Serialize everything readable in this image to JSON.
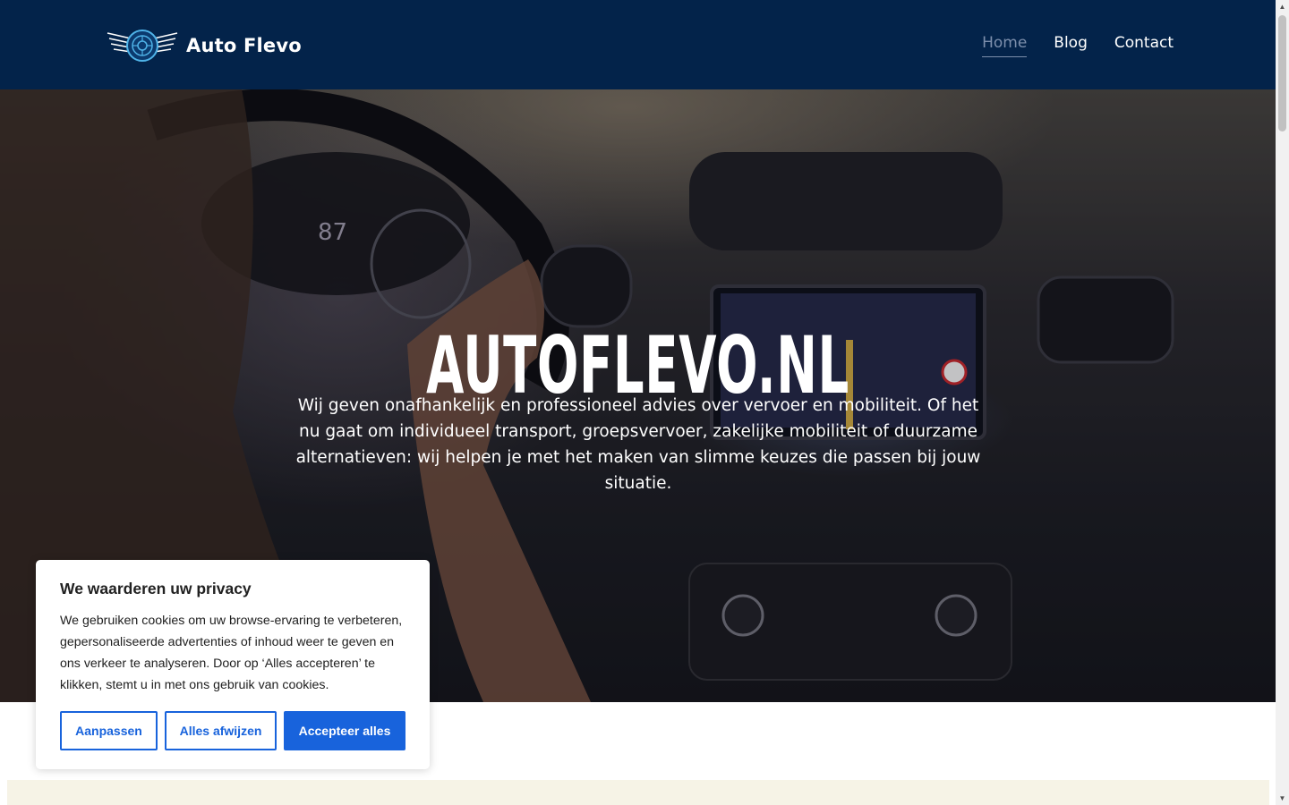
{
  "brand": {
    "name": "Auto Flevo",
    "logo_icon": "winged-wheel-icon"
  },
  "nav": {
    "items": [
      {
        "label": "Home",
        "active": true
      },
      {
        "label": "Blog",
        "active": false
      },
      {
        "label": "Contact",
        "active": false
      }
    ]
  },
  "hero": {
    "title": "AUTOFLEVO.NL",
    "subtitle": "Wij geven onafhankelijk en professioneel advies over vervoer en mobiliteit. Of het nu gaat om individueel transport, groepsvervoer, zakelijke mobiliteit of duurzame alternatieven: wij helpen je met het maken van slimme keuzes die passen bij jouw situatie."
  },
  "cookie_banner": {
    "title": "We waarderen uw privacy",
    "text": "We gebruiken cookies om uw browse-ervaring te verbeteren, gepersonaliseerde advertenties of inhoud weer te geven en ons verkeer te analyseren. Door op ‘Alles accepteren’ te klikken, stemt u in met ons gebruik van cookies.",
    "buttons": {
      "customize": "Aanpassen",
      "reject": "Alles afwijzen",
      "accept": "Accepteer alles"
    }
  },
  "colors": {
    "header_bg": "#03234a",
    "nav_active": "#7d8fac",
    "cookie_primary": "#1863dc",
    "section_bg": "#f6f3e6"
  }
}
